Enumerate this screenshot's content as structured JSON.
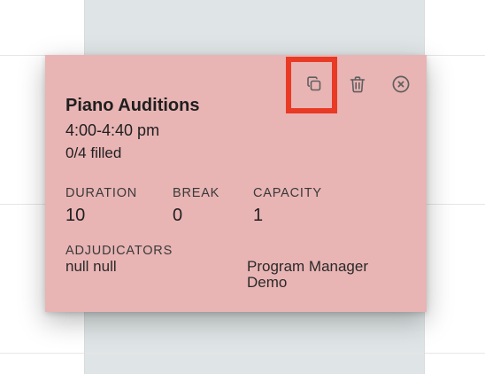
{
  "event": {
    "title": "Piano Auditions",
    "time_range": "4:00-4:40 pm",
    "filled": "0/4 filled"
  },
  "stats": [
    {
      "label": "DURATION",
      "value": "10"
    },
    {
      "label": "BREAK",
      "value": "0"
    },
    {
      "label": "CAPACITY",
      "value": "1"
    }
  ],
  "adjudicators": {
    "label": "ADJUDICATORS",
    "names": [
      "null null",
      "Program Manager Demo"
    ]
  },
  "actions": {
    "copy_icon": "copy-icon",
    "delete_icon": "trash-icon",
    "close_icon": "close-circle-icon"
  },
  "colors": {
    "popup_background": "#e9b4b4",
    "highlight": "#e83a24"
  }
}
